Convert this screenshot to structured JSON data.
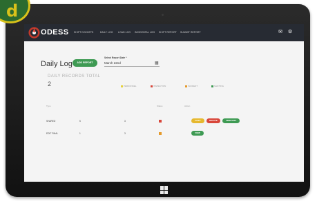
{
  "badge": {
    "letter": "d"
  },
  "app": {
    "brand": "ODESS"
  },
  "nav": {
    "links": [
      "SHIFT DOCKETS",
      "DAILY LOG",
      "LOAD LOG",
      "INCIDENTAL LOG",
      "SHIFT REPORT",
      "SUMMIT REPORT"
    ],
    "mail_icon": "mail-icon",
    "settings_icon": "gear-icon"
  },
  "page": {
    "title": "Daily Log",
    "add_button": "ADD REPORT",
    "date_label": "Select Report Date *",
    "date_value": "March 22nd",
    "calendar_icon": "calendar-icon",
    "records_label": "DAILY RECORDS TOTAL",
    "records_count": "2"
  },
  "legend": [
    {
      "label": "PERSONNEL",
      "color": "#e6d23a"
    },
    {
      "label": "INSPECTION",
      "color": "#d8463a"
    },
    {
      "label": "INCIDENT",
      "color": "#e59a2b"
    },
    {
      "label": "SHIFTING",
      "color": "#3e9a53"
    }
  ],
  "table": {
    "headers": [
      "Type",
      "",
      "",
      "Status",
      "Action"
    ],
    "rows": [
      {
        "type": "SHARED",
        "col2": "5",
        "col3": "3",
        "status_color": "#d8463a",
        "actions": [
          {
            "label": "COPY",
            "color": "#e6b82e"
          },
          {
            "label": "DELETE",
            "color": "#d8463a"
          },
          {
            "label": "VIEW EDIT",
            "color": "#3e9a53"
          }
        ]
      },
      {
        "type": "EDIT FINAL",
        "col2": "1",
        "col3": "3",
        "status_color": "#e59a2b",
        "actions": [
          {
            "label": "VIEW",
            "color": "#3e9a53"
          }
        ]
      }
    ]
  },
  "colors": {
    "navbar": "#272b33",
    "accent": "#3e9a53",
    "badge": "#2c6b2f",
    "badge_ring": "#d9c21a"
  }
}
